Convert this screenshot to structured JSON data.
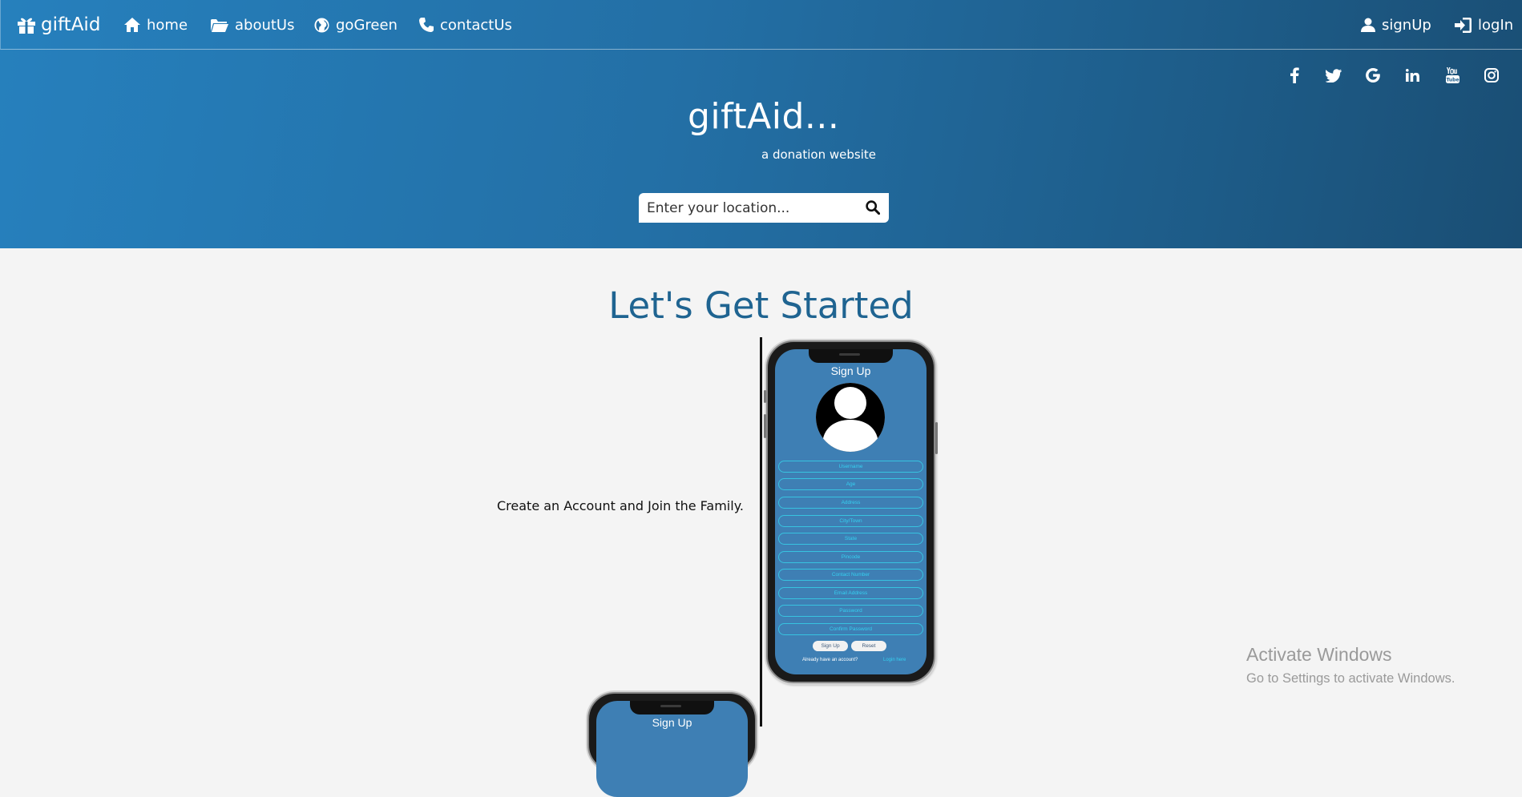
{
  "nav": {
    "brand": "giftAid",
    "items": [
      {
        "label": "home",
        "icon": "home-icon"
      },
      {
        "label": "aboutUs",
        "icon": "folder-open-icon"
      },
      {
        "label": "goGreen",
        "icon": "globe-icon"
      },
      {
        "label": "contactUs",
        "icon": "phone-icon"
      }
    ],
    "auth": [
      {
        "label": "signUp",
        "icon": "user-icon"
      },
      {
        "label": "logIn",
        "icon": "log-in-icon"
      }
    ]
  },
  "social": [
    "facebook-icon",
    "twitter-icon",
    "google-icon",
    "linkedin-icon",
    "youtube-icon",
    "instagram-icon"
  ],
  "hero": {
    "title": "giftAid...",
    "tagline": "a donation website",
    "search_placeholder": "Enter your location..."
  },
  "main": {
    "heading": "Let's Get Started",
    "step_text": "Create an Account and Join the Family."
  },
  "phone": {
    "title": "Sign Up",
    "fields": [
      "Username",
      "Age",
      "Address",
      "City/Town",
      "State",
      "Pincode",
      "Contact Number",
      "Email Address",
      "Password",
      "Confirm Password"
    ],
    "signup_btn": "Sign Up",
    "reset_btn": "Reset",
    "footer_text": "Already have an account?",
    "footer_link": "Login here"
  },
  "phone2": {
    "title": "Sign Up"
  },
  "watermark": {
    "title": "Activate Windows",
    "subtitle": "Go to Settings to activate Windows."
  },
  "colors": {
    "banner_start": "#2680bd",
    "banner_end": "#1a4e74",
    "heading": "#1f6491",
    "phone_screen": "#3e7fb4",
    "field_accent": "#35d0f0"
  }
}
